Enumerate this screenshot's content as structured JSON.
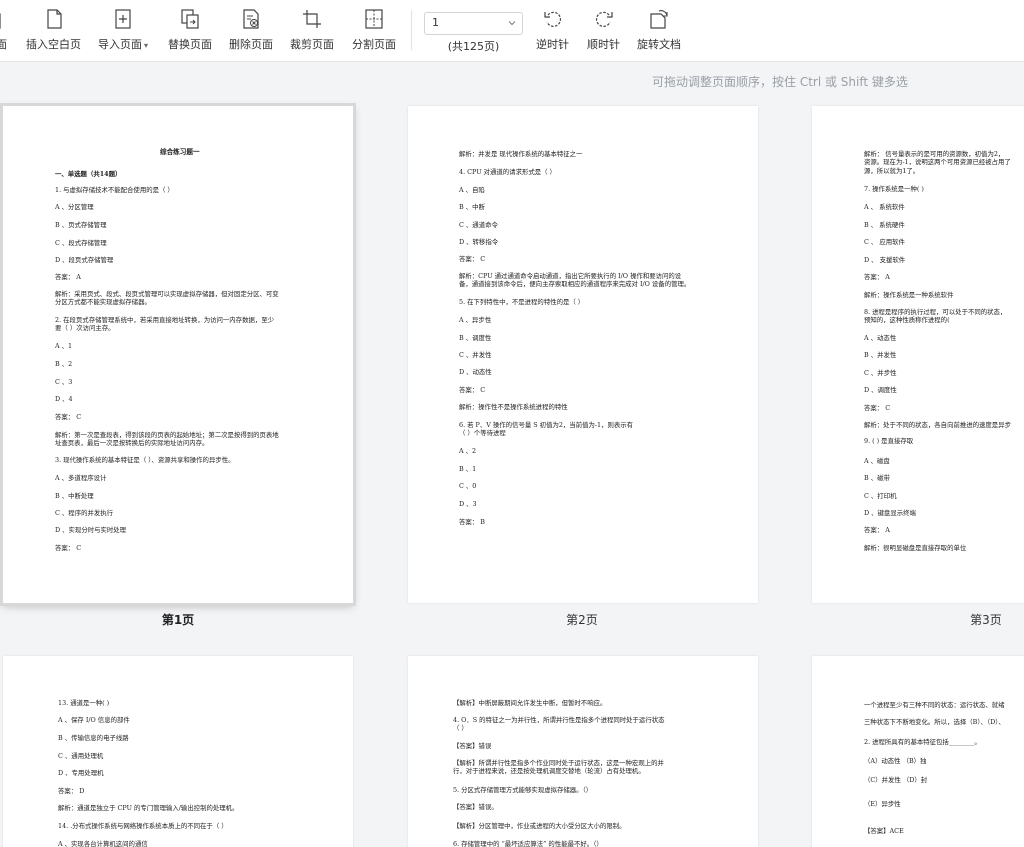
{
  "toolbar": {
    "items": [
      {
        "label": "面",
        "icon": "page-icon"
      },
      {
        "label": "插入空白页",
        "icon": "blank-page-icon"
      },
      {
        "label": "导入页面",
        "icon": "import-page-icon"
      },
      {
        "label": "替换页面",
        "icon": "replace-page-icon"
      },
      {
        "label": "删除页面",
        "icon": "delete-page-icon"
      },
      {
        "label": "裁剪页面",
        "icon": "crop-page-icon"
      },
      {
        "label": "分割页面",
        "icon": "split-page-icon"
      },
      {
        "label": "逆时针",
        "icon": "rotate-ccw-icon"
      },
      {
        "label": "顺时针",
        "icon": "rotate-cw-icon"
      },
      {
        "label": "旋转文档",
        "icon": "rotate-doc-icon"
      }
    ],
    "page_select_value": "1",
    "page_count": "(共125页)"
  },
  "hint": "可拖动调整页面顺序，按住 Ctrl 或 Shift 键多选",
  "colors": {
    "toolbar_bg": "#ffffff",
    "canvas_bg": "#f3f4f6",
    "hint": "#9aa0a6"
  },
  "pages": [
    {
      "label": "第1页",
      "lines": [
        "综合练习题一",
        "一、单选题（共14题）",
        "1. 与虚拟存储技术不能配合使用的是（        ）",
        "A 、分区管理",
        "B 、页式存储管理",
        "C 、段式存储管理",
        "D 、段页式存储管理",
        "答案： A",
        "解析：采用页式、段式、段页式管理可以实现虚拟存储器，但对固定分区、可变",
        "分区方式都不能实现虚拟存储器。",
        "2. 在段页式存储管理系统中，若采用直接地址转换，为访问一内存数据，至少",
        "要（                ）次访问主存。",
        "A 、1",
        "B 、2",
        "C 、3",
        "D 、4",
        "答案： C",
        "解析：第一次是查段表，得到该段的页表的起始地址；第二次是按得到的页表地",
        "址查页表，最后一次是按转换后的实际地址访问内存。",
        "3.   现代操作系统的基本特征是（          ）、资源共享和操作的异步性。",
        "A 、多道程序设计",
        "B 、中断处理",
        "C 、程序的并发执行",
        "D 、实现分时与实时处理",
        "答案： C"
      ]
    },
    {
      "label": "第2页",
      "lines": [
        "解析：并发是   现代操作系统的基本特征之一",
        "4. CPU 对通道的请求形式是（                           ）",
        "A 、自陷",
        "B 、中断",
        "C 、通道命令",
        "D 、转移指令",
        "答案： C",
        "解析：CPU 通过通道命令启动通道，指出它所要执行的 I/O 操作和要访问的设",
        "备，通道接到该命令后，便向主存索取相应的通道程序来完成对 I/O 设备的管理。",
        "5. 在下列特性中，不是进程的特性的是（        ）",
        "A 、异步性",
        "B 、调度性",
        "C 、并发性",
        "D 、动态性",
        "答案： C",
        "解析：操作性不是操作系统进程的特性",
        "6. 若 P、V 操作的信号量 S 初值为2，当前值为-1，则表示有",
        "（                                ）个等待进程",
        "A 、2",
        "B 、1",
        "C 、0",
        "D 、3",
        "答案： B"
      ]
    },
    {
      "label": "第3页",
      "lines": [
        "解析：    信号量表示的是可用的资源数，初值为2，",
        "资源。现在为-1，说明这两个可用资源已经被占用了",
        "源，所以就为1了。",
        "7. 操作系统是一种(          )",
        "A 、    系统软件",
        "B 、    系统硬件",
        "C 、    应用软件",
        "D 、    支援软件",
        "答案： A",
        "解析：操作系统是一种系统软件",
        "8. 进程是程序的执行过程，可以处于不同的状态，",
        "预知的，这种性质称作进程的(",
        "A 、动态性",
        "B 、并发性",
        "C 、并步性",
        "D 、调度性",
        "答案： C",
        "解析：处于不同的状态，各自向前推进的速度是异步",
        "9. (                          )   是直接存取",
        "A 、磁盘",
        "B 、磁带",
        "C 、打印机",
        "D 、键盘显示终端",
        "答案： A",
        "解析：很明显磁盘是直接存取的单位"
      ]
    },
    {
      "lines": [
        "13. 通道是一种(                              )",
        "A 、保存 I/O 信息的部件",
        "B 、传输信息的电子线路",
        "C 、通用处理机",
        "D 、专用处理机",
        "答案： D",
        "解析：通道是独立于 CPU 的专门管理输入/输出控制的处理机。",
        "14. .分布式操作系统与网络操作系统本质上的不同在于（            ）",
        "A 、实现各台计算机这间的通信"
      ]
    },
    {
      "lines": [
        "【解析】中断屏蔽期间允许发生中断，但暂时不响应。",
        "4. O．S 的特征之一为并行性，所谓并行性是指多个进程同时处于运行状态",
        "（ ）",
        "【答案】错误",
        "【解析】所谓并行性是指多个作业同时处于运行状态，这是一种宏观上的并",
        "行，对于进程来说，还是按处理机调度交替地（轮流）占有处理机。",
        "5. 分区式存储管理方式能够实现虚拟存储器。（）",
        "【答案】错误。",
        "【解析】分区管理中，作业或进程的大小受分区大小的限制。",
        "6. 存储管理中的 “最坏适应算法” 的性能最不好。（）"
      ]
    },
    {
      "lines": [
        "一个进程至少有三种不同的状态：运行状态、就绪",
        "三种状态下不断地变化。所以，选择（B）、（D）、",
        "2. 进程所具有的基本特征包括________。",
        "（A）动态性                                  （B）独",
        "（C）并发性                                  （D）封",
        "（E）异步性",
        "【答案】ACE"
      ]
    }
  ]
}
